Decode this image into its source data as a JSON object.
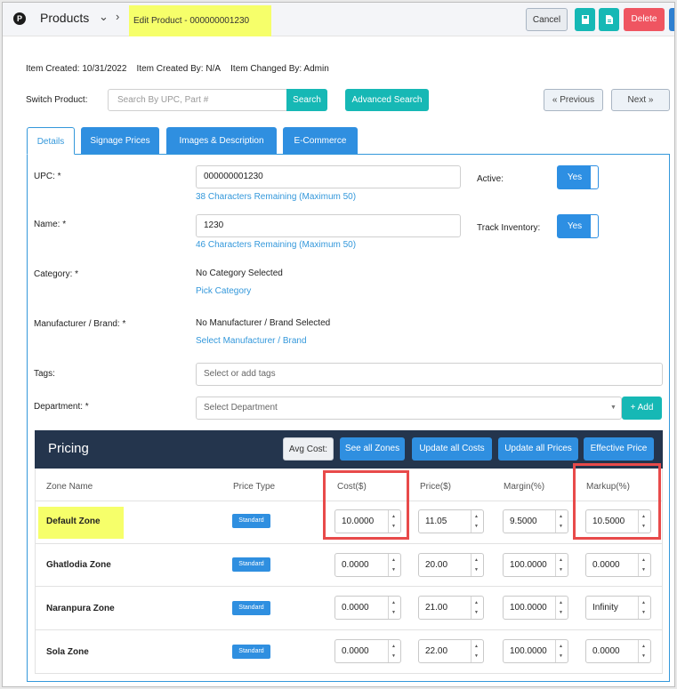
{
  "app": {
    "logo": "P",
    "module": "Products",
    "edit_title": "Edit Product - 000000001230"
  },
  "toolbar": {
    "cancel": "Cancel",
    "delete": "Delete",
    "icon1": "save-icon",
    "icon2": "document-icon"
  },
  "meta": {
    "created": "Item Created: 10/31/2022",
    "created_by": "Item Created By: N/A",
    "changed_by": "Item Changed By: Admin"
  },
  "switch": {
    "label": "Switch Product:",
    "placeholder": "Search By UPC, Part #",
    "search": "Search",
    "advanced": "Advanced Search",
    "previous": "« Previous",
    "next": "Next »"
  },
  "tabs": [
    "Details",
    "Signage Prices",
    "Images & Description",
    "E-Commerce"
  ],
  "form": {
    "upc_label": "UPC: *",
    "upc_value": "000000001230",
    "upc_hint": "38 Characters Remaining (Maximum 50)",
    "active_label": "Active:",
    "active_value": "Yes",
    "name_label": "Name: *",
    "name_value": "1230",
    "name_hint": "46 Characters Remaining (Maximum 50)",
    "track_label": "Track Inventory:",
    "track_value": "Yes",
    "category_label": "Category: *",
    "category_value": "No Category Selected",
    "category_link": "Pick Category",
    "manufacturer_label": "Manufacturer / Brand: *",
    "manufacturer_value": "No Manufacturer / Brand Selected",
    "manufacturer_link": "Select Manufacturer / Brand",
    "tags_label": "Tags:",
    "tags_placeholder": "Select or add tags",
    "department_label": "Department: *",
    "department_placeholder": "Select Department",
    "add": "+ Add"
  },
  "pricing": {
    "title": "Pricing",
    "buttons": [
      "Avg Cost:",
      "See all Zones",
      "Update all Costs",
      "Update all Prices",
      "Effective Price"
    ],
    "columns": [
      "Zone Name",
      "Price Type",
      "Cost($)",
      "Price($)",
      "Margin(%)",
      "Markup(%)"
    ],
    "rows": [
      {
        "zone": "Default Zone",
        "type": "Standard",
        "cost": "10.0000",
        "price": "11.05",
        "margin": "9.5000",
        "markup": "10.5000"
      },
      {
        "zone": "Ghatlodia Zone",
        "type": "Standard",
        "cost": "0.0000",
        "price": "20.00",
        "margin": "100.0000",
        "markup": "0.0000"
      },
      {
        "zone": "Naranpura Zone",
        "type": "Standard",
        "cost": "0.0000",
        "price": "21.00",
        "margin": "100.0000",
        "markup": "Infinity"
      },
      {
        "zone": "Sola Zone",
        "type": "Standard",
        "cost": "0.0000",
        "price": "22.00",
        "margin": "100.0000",
        "markup": "0.0000"
      }
    ]
  },
  "colors": {
    "accent": "#16b8b5",
    "primary": "#2f8fe0",
    "danger": "#ef5561",
    "header": "#24354d",
    "highlight": "#f6ff6a",
    "annotation": "#e84a4a"
  }
}
